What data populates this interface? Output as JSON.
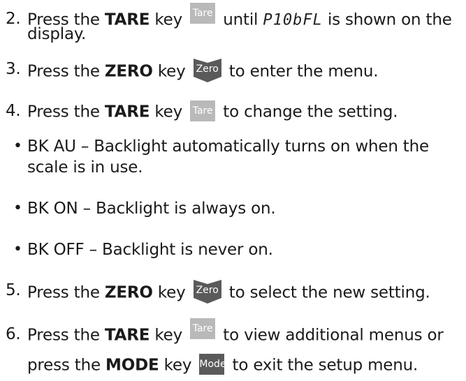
{
  "steps": {
    "s2": {
      "num": "2.",
      "pre": "Press the ",
      "bold": "TARE",
      "mid": " key",
      "key_label": "Tare",
      "post1": " until ",
      "display_code": "P10bFL",
      "post2": " is shown on the",
      "cont": "display."
    },
    "s3": {
      "num": "3.",
      "pre": "Press the ",
      "bold": "ZERO",
      "mid": " key",
      "key_label": "Zero",
      "post": " to enter the menu."
    },
    "s4": {
      "num": "4.",
      "pre": "Press the ",
      "bold": "TARE",
      "mid": " key",
      "key_label": "Tare",
      "post": " to change the setting."
    },
    "bullets": [
      {
        "line1": "BK AU – Backlight automatically turns on when the",
        "line2": "scale is in use."
      },
      {
        "line1": "BK ON – Backlight is always on."
      },
      {
        "line1": "BK OFF – Backlight is never on."
      }
    ],
    "s5": {
      "num": "5.",
      "pre": "Press the ",
      "bold": "ZERO",
      "mid": " key",
      "key_label": "Zero",
      "post": " to select the new setting."
    },
    "s6": {
      "num": "6.",
      "pre": "Press the ",
      "bold": "TARE",
      "mid": " key",
      "key_label": "Tare",
      "post": " to view additional menus or",
      "l2_pre": "press the ",
      "l2_bold": "MODE",
      "l2_mid": " key",
      "l2_key_label": "Mode",
      "l2_post": " to exit the setup menu."
    }
  },
  "bullet_char": "•",
  "colors": {
    "tare_key": "#b9b9b9",
    "zero_key": "#5a5a5a",
    "mode_key": "#5a5a5a",
    "text": "#1a1a1a"
  }
}
